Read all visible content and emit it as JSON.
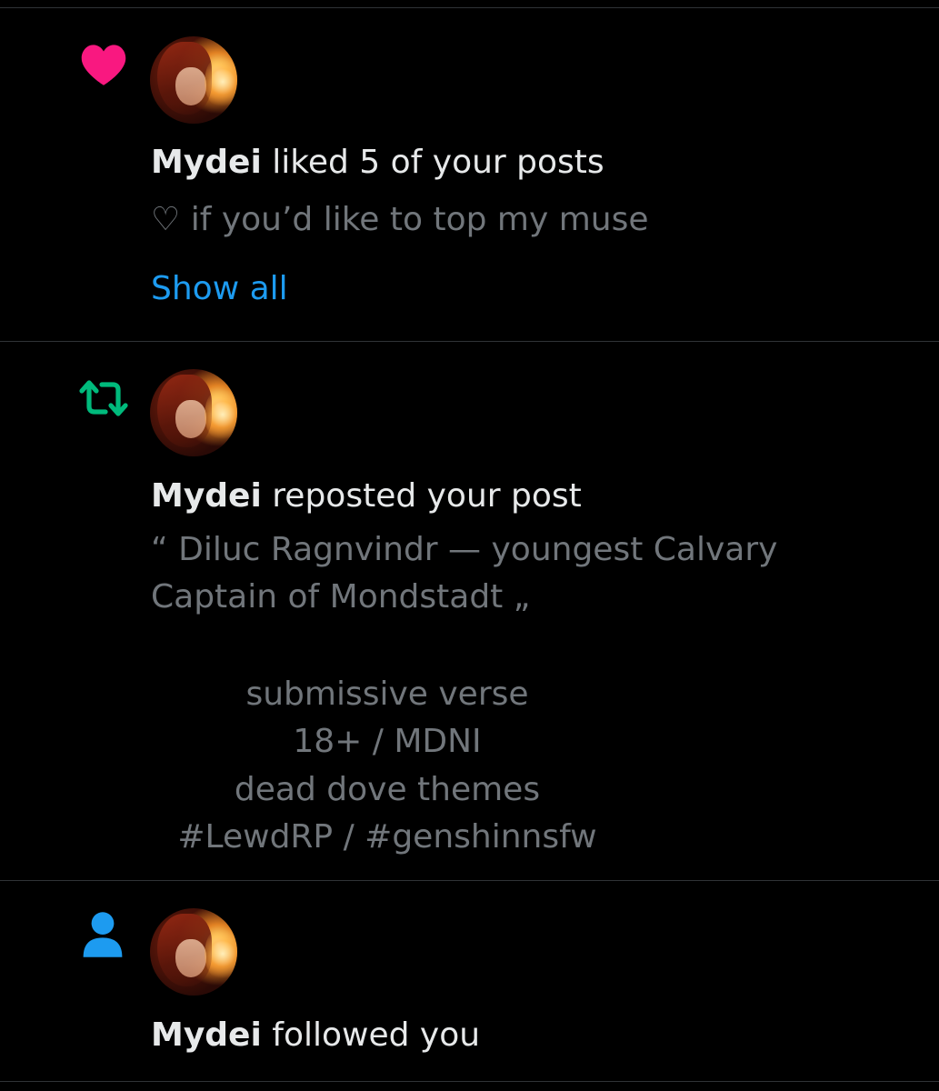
{
  "colors": {
    "background": "#000000",
    "divider": "#2f3336",
    "primary_text": "#e7e9ea",
    "secondary_text": "#71767b",
    "link": "#1d9bf0",
    "like": "#f91880",
    "repost": "#00ba7c",
    "follow": "#1d9bf0"
  },
  "notifications": [
    {
      "type": "like",
      "icon": "heart-icon",
      "user": "Mydei",
      "action": "liked 5 of your posts",
      "preview": "♡ if you’d like to top my muse",
      "link": "Show all"
    },
    {
      "type": "repost",
      "icon": "repost-icon",
      "user": "Mydei",
      "action": "reposted your post",
      "preview_lines": [
        "“ Diluc Ragnvindr — youngest Calvary",
        "Captain of Mondstadt „"
      ],
      "centered_lines": [
        "submissive verse",
        "18+ / MDNI",
        "dead dove themes",
        "#LewdRP / #genshinnsfw"
      ]
    },
    {
      "type": "follow",
      "icon": "person-icon",
      "user": "Mydei",
      "action": "followed you"
    }
  ]
}
